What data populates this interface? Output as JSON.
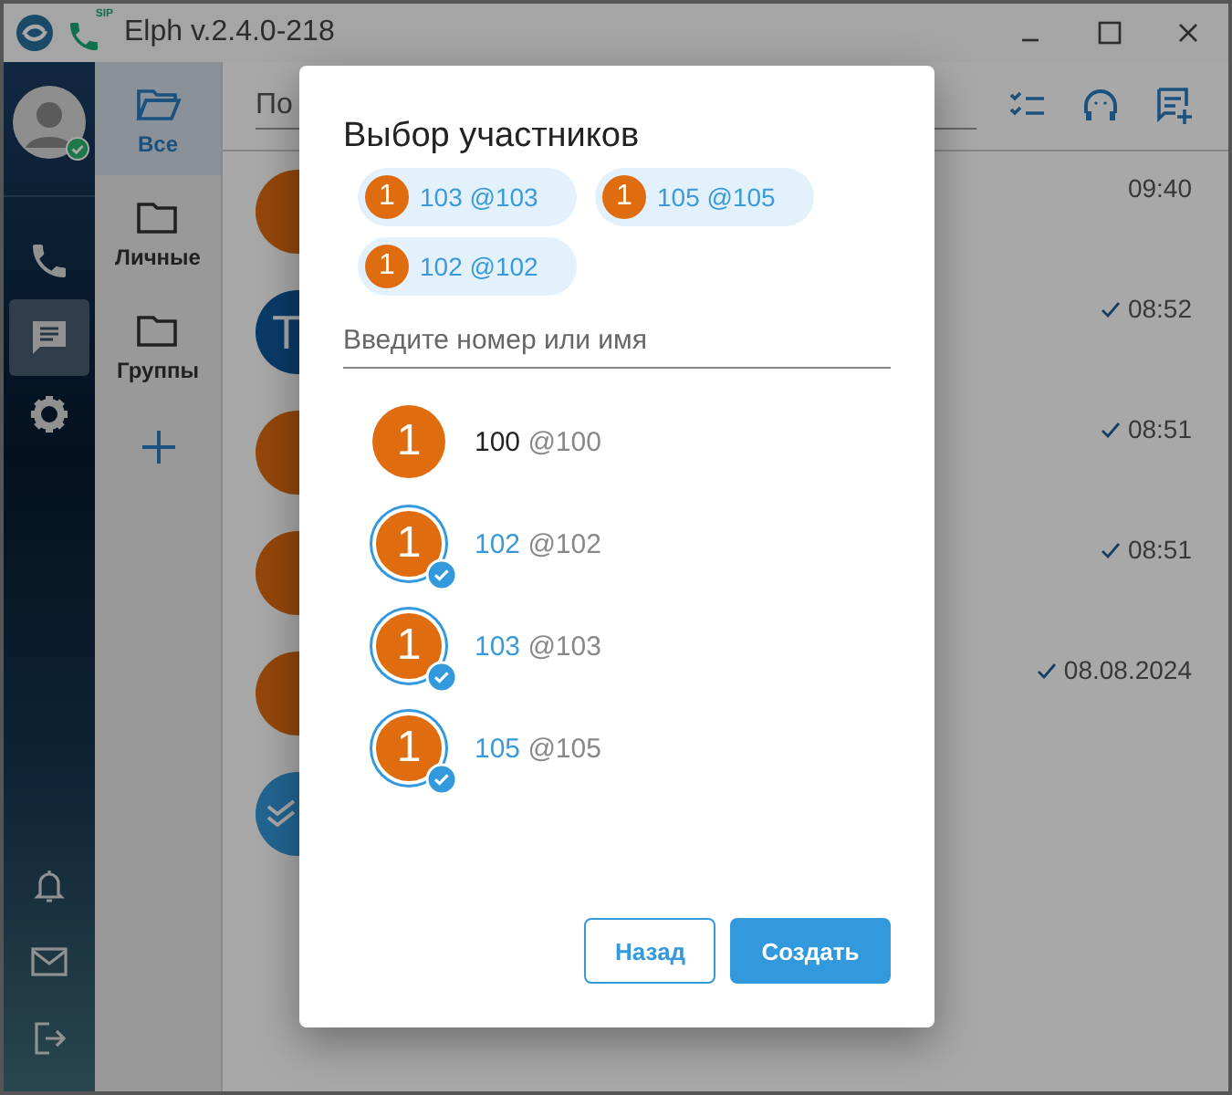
{
  "window": {
    "title": "Elph v.2.4.0-218",
    "phone_badge": "SIP"
  },
  "rail": {
    "top": [
      {
        "kind": "phone",
        "selected": false
      },
      {
        "kind": "chat",
        "selected": true
      },
      {
        "kind": "settings",
        "selected": false
      }
    ],
    "bottom": [
      {
        "kind": "bell",
        "selected": false
      },
      {
        "kind": "mail",
        "selected": false
      },
      {
        "kind": "logout",
        "selected": false
      }
    ]
  },
  "folders": [
    {
      "label": "Все",
      "selected": true
    },
    {
      "label": "Личные",
      "selected": false
    },
    {
      "label": "Группы",
      "selected": false
    }
  ],
  "search": {
    "placeholder": "По"
  },
  "chats": [
    {
      "kind": "letter",
      "color": "#94470b",
      "time": "09:40",
      "read": false
    },
    {
      "kind": "letter",
      "avatar": "T",
      "color": "#093b68",
      "time": "08:52",
      "read": true
    },
    {
      "kind": "letter",
      "color": "#94470b",
      "time": "08:51",
      "read": true
    },
    {
      "kind": "letter",
      "color": "#94470b",
      "time": "08:51",
      "read": true
    },
    {
      "kind": "letter",
      "color": "#94470b",
      "time": "08.08.2024",
      "read": true
    },
    {
      "kind": "check",
      "color": "#226592"
    }
  ],
  "dialog": {
    "title": "Выбор участников",
    "chips": [
      {
        "avatar": "1",
        "label": "103 @103"
      },
      {
        "avatar": "1",
        "label": "105 @105"
      },
      {
        "avatar": "1",
        "label": "102 @102"
      }
    ],
    "input": {
      "placeholder": "Введите номер или имя"
    },
    "contacts": [
      {
        "avatar": "1",
        "number": "100",
        "handle": "@100",
        "selected": false
      },
      {
        "avatar": "1",
        "number": "102",
        "handle": "@102",
        "selected": true
      },
      {
        "avatar": "1",
        "number": "103",
        "handle": "@103",
        "selected": true
      },
      {
        "avatar": "1",
        "number": "105",
        "handle": "@105",
        "selected": true
      }
    ],
    "buttons": [
      {
        "label": "Назад",
        "kind": "outline"
      },
      {
        "label": "Создать",
        "kind": "primary"
      }
    ]
  }
}
